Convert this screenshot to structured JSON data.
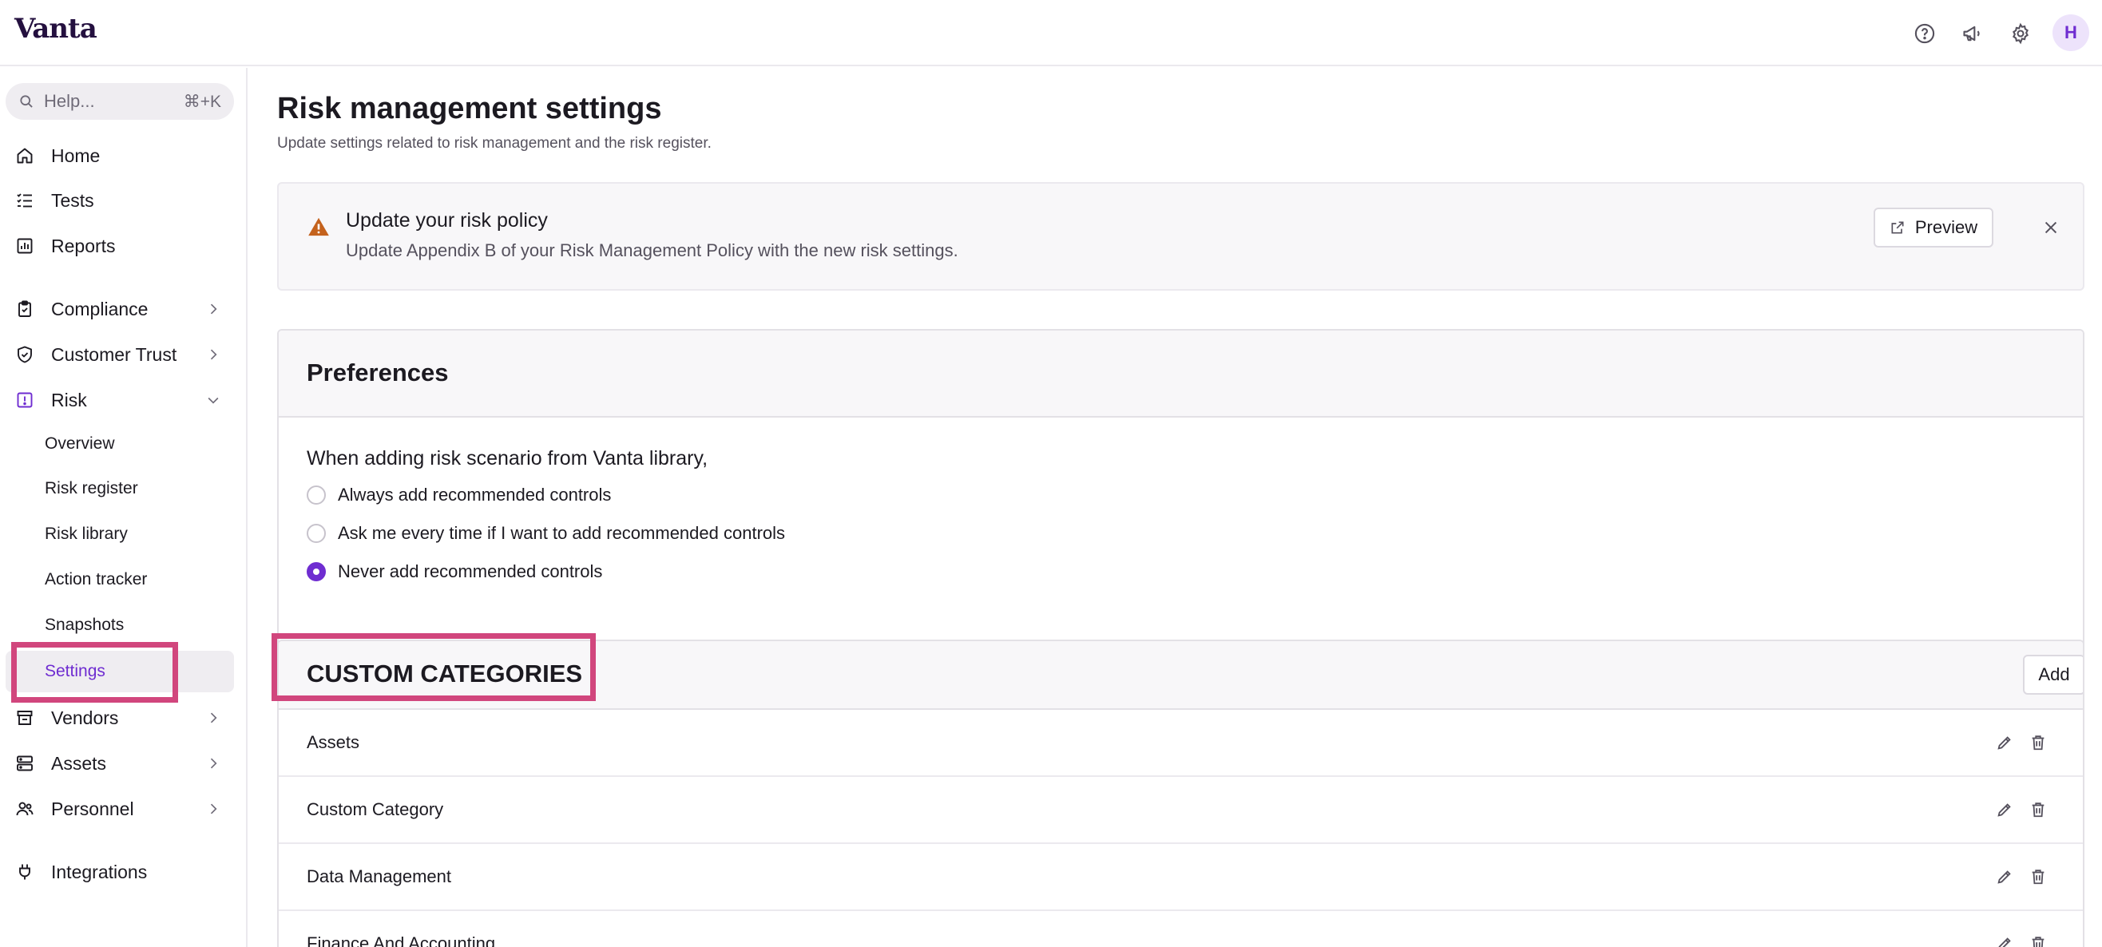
{
  "app": {
    "logo": "Vanta",
    "avatar_initial": "H"
  },
  "topbar": {
    "icons": [
      "help-circle-icon",
      "megaphone-icon",
      "gear-icon"
    ]
  },
  "sidebar": {
    "search": {
      "placeholder": "Help...",
      "shortcut": "⌘+K"
    },
    "items": [
      {
        "label": "Home",
        "icon": "home-icon"
      },
      {
        "label": "Tests",
        "icon": "list-check-icon"
      },
      {
        "label": "Reports",
        "icon": "chart-icon"
      },
      {
        "label": "Compliance",
        "icon": "clipboard-check-icon"
      },
      {
        "label": "Customer Trust",
        "icon": "shield-check-icon"
      },
      {
        "label": "Risk",
        "icon": "risk-alert-icon"
      },
      {
        "label": "Vendors",
        "icon": "store-icon"
      },
      {
        "label": "Assets",
        "icon": "server-icon"
      },
      {
        "label": "Personnel",
        "icon": "people-icon"
      },
      {
        "label": "Integrations",
        "icon": "plug-icon"
      }
    ],
    "risk_subitems": [
      {
        "label": "Overview"
      },
      {
        "label": "Risk register"
      },
      {
        "label": "Risk library"
      },
      {
        "label": "Action tracker"
      },
      {
        "label": "Snapshots"
      },
      {
        "label": "Settings"
      }
    ],
    "accent_color": "#6f2dd1"
  },
  "main": {
    "title": "Risk management settings",
    "subtitle": "Update settings related to risk management and the risk register.",
    "banner": {
      "title": "Update your risk policy",
      "text": "Update Appendix B of your Risk Management Policy with the new risk settings.",
      "preview_label": "Preview",
      "warning_color": "#c4621d"
    },
    "preferences": {
      "title": "Preferences",
      "question": "When adding risk scenario from Vanta library,",
      "options": [
        {
          "label": "Always add recommended controls",
          "checked": false
        },
        {
          "label": "Ask me every time if I want to add recommended controls",
          "checked": false
        },
        {
          "label": "Never add recommended controls",
          "checked": true
        }
      ]
    },
    "custom_categories": {
      "title": "CUSTOM CATEGORIES",
      "add_label": "Add",
      "rows": [
        {
          "name": "Assets"
        },
        {
          "name": "Custom Category"
        },
        {
          "name": "Data Management"
        },
        {
          "name": "Finance And Accounting"
        }
      ]
    },
    "highlight_color": "#d1467d"
  }
}
